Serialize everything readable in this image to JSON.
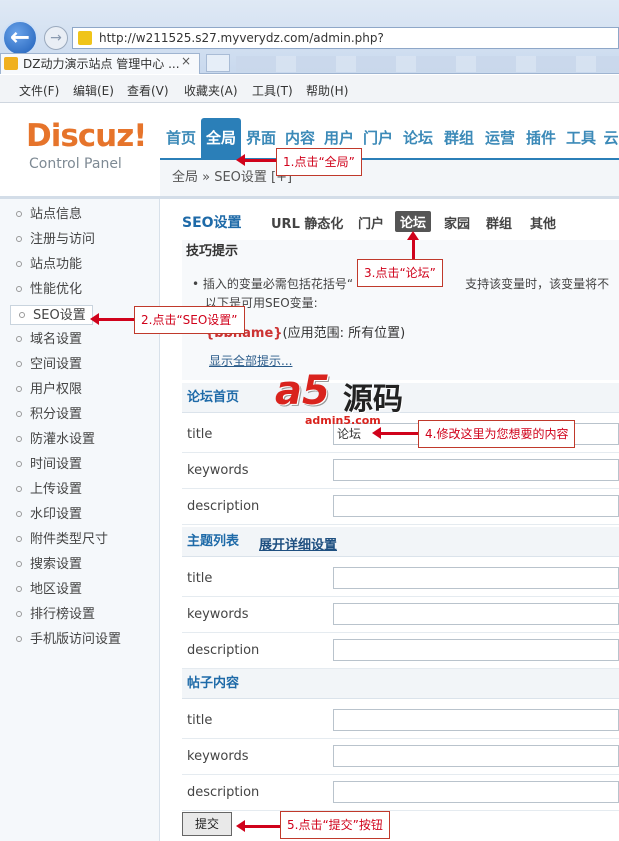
{
  "browser": {
    "url": "http://w211525.s27.myverydz.com/admin.php?",
    "tab_title": "DZ动力演示站点 管理中心 ...",
    "tab_close": "×",
    "back_glyph": "←",
    "forward_glyph": "→",
    "menu": [
      "文件(F)",
      "编辑(E)",
      "查看(V)",
      "收藏夹(A)",
      "工具(T)",
      "帮助(H)"
    ]
  },
  "header": {
    "logo": "Discuz!",
    "logo_sub": "Control Panel",
    "nav": [
      "首页",
      "全局",
      "界面",
      "内容",
      "用户",
      "门户",
      "论坛",
      "群组",
      "运营",
      "插件",
      "工具",
      "云"
    ],
    "active_nav": "全局",
    "breadcrumb": "全局 » SEO设置 [+]"
  },
  "sidebar": {
    "items": [
      "站点信息",
      "注册与访问",
      "站点功能",
      "性能优化",
      "SEO设置",
      "域名设置",
      "空间设置",
      "用户权限",
      "积分设置",
      "防灌水设置",
      "时间设置",
      "上传设置",
      "水印设置",
      "附件类型尺寸",
      "搜索设置",
      "地区设置",
      "排行榜设置",
      "手机版访问设置"
    ],
    "active": "SEO设置"
  },
  "content": {
    "title": "SEO设置",
    "subtabs": [
      "URL 静态化",
      "门户",
      "论坛",
      "家园",
      "群组",
      "其他"
    ],
    "active_subtab": "论坛",
    "tips_title": "技巧提示",
    "tip_line1": "插入的变量必需包括花括号“",
    "tip_line1_tail": "支持该变量时，该变量将不",
    "tip_line2": "以下是可用SEO变量:",
    "tip_var": "{bbname}",
    "tip_var_scope": "(应用范围: 所有位置)",
    "tip_more": "显示全部提示...",
    "sections": [
      {
        "title": "论坛首页",
        "link": "",
        "fields": [
          {
            "label": "title",
            "value": "论坛"
          },
          {
            "label": "keywords",
            "value": ""
          },
          {
            "label": "description",
            "value": ""
          }
        ]
      },
      {
        "title": "主题列表",
        "link": "展开详细设置",
        "fields": [
          {
            "label": "title",
            "value": ""
          },
          {
            "label": "keywords",
            "value": ""
          },
          {
            "label": "description",
            "value": ""
          }
        ]
      },
      {
        "title": "帖子内容",
        "link": "",
        "fields": [
          {
            "label": "title",
            "value": ""
          },
          {
            "label": "keywords",
            "value": ""
          },
          {
            "label": "description",
            "value": ""
          }
        ]
      }
    ],
    "submit": "提交"
  },
  "annotations": {
    "step1": "1.点击“全局”",
    "step2": "2.点击“SEO设置”",
    "step3": "3.点击“论坛”",
    "step4": "4.修改这里为您想要的内容",
    "step5": "5.点击“提交”按钮"
  },
  "watermark": {
    "brand": "a5",
    "text": "源码",
    "url": "admin5.com"
  },
  "colors": {
    "accent": "#2b7fb8",
    "logo": "#e6742b",
    "annotation": "#d0021b"
  }
}
